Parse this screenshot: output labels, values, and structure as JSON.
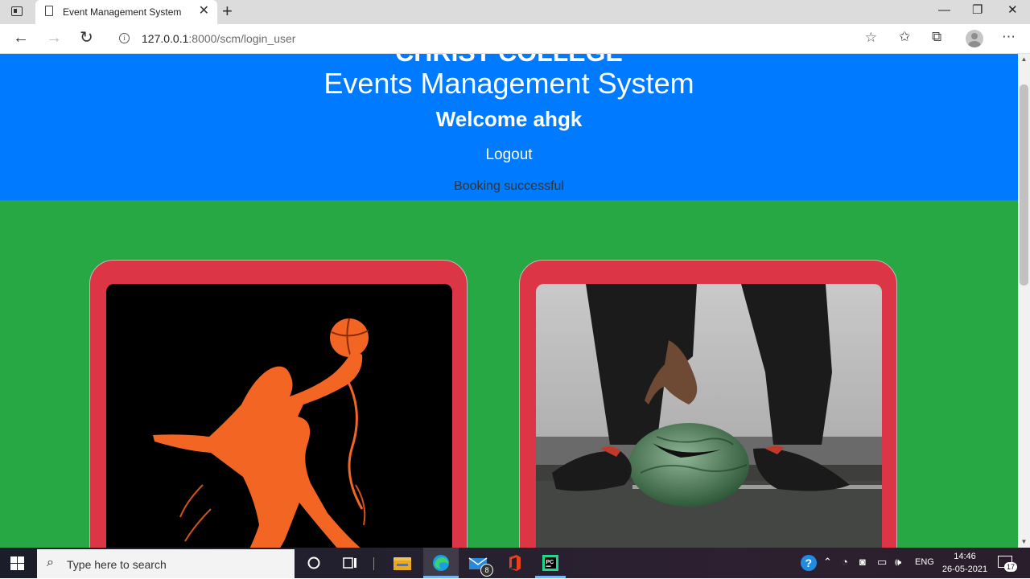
{
  "browser": {
    "tab_title": "Event Management System",
    "url_host": "127.0.0.1",
    "url_rest": ":8000/scm/login_user"
  },
  "page": {
    "college_name": "CHRIST COLLEGE",
    "system_title": "Events Management System",
    "welcome": "Welcome ahgk",
    "logout": "Logout",
    "message": "Booking successful",
    "cards": [
      {
        "image": "basketball-player-silhouette"
      },
      {
        "image": "rugby-ball-nike-player"
      }
    ]
  },
  "colors": {
    "header": "#007bff",
    "body": "#28a745",
    "card": "#dc3545"
  },
  "taskbar": {
    "search_placeholder": "Type here to search",
    "mail_badge": "8",
    "language": "ENG",
    "time": "14:46",
    "date": "26-05-2021",
    "notification_count": "17"
  }
}
